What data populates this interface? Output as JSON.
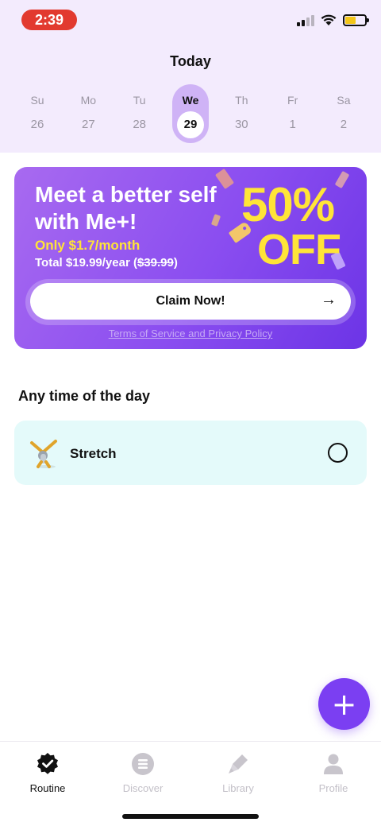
{
  "status": {
    "time": "2:39"
  },
  "header": {
    "title": "Today"
  },
  "week": [
    {
      "name": "Su",
      "num": "26"
    },
    {
      "name": "Mo",
      "num": "27"
    },
    {
      "name": "Tu",
      "num": "28"
    },
    {
      "name": "We",
      "num": "29"
    },
    {
      "name": "Th",
      "num": "30"
    },
    {
      "name": "Fr",
      "num": "1"
    },
    {
      "name": "Sa",
      "num": "2"
    }
  ],
  "promo": {
    "title": "Meet a better self with Me+!",
    "monthly": "Only $1.7/month",
    "total_prefix": "Total $19.99/year (",
    "total_strike": "$39.99",
    "total_suffix": ")",
    "discount_number": "50%",
    "discount_word": "OFF",
    "button_label": "Claim Now!",
    "button_arrow": "→",
    "terms": "Terms of Service and Privacy Policy"
  },
  "routine": {
    "section_title": "Any time of the day",
    "habit_name": "Stretch"
  },
  "fab": {
    "label": "+"
  },
  "tabs": [
    {
      "label": "Routine",
      "icon": "badge-check-icon"
    },
    {
      "label": "Discover",
      "icon": "list-icon"
    },
    {
      "label": "Library",
      "icon": "pen-icon"
    },
    {
      "label": "Profile",
      "icon": "person-icon"
    }
  ],
  "colors": {
    "accent": "#7b3ff2",
    "promo_yellow": "#ffe438",
    "header_bg": "#f3ebfd",
    "habit_bg": "#e4fafa",
    "status_pill": "#e23a2f"
  }
}
